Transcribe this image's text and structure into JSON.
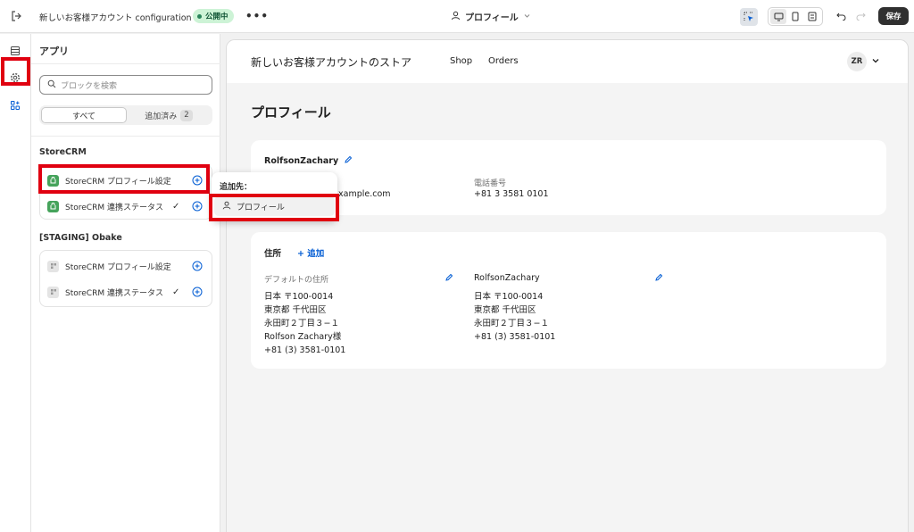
{
  "topbar": {
    "title": "新しいお客様アカウント configuration",
    "status": "公開中",
    "more": "•••",
    "page_selector": "プロフィール",
    "save": "保存"
  },
  "sidebar": {
    "title": "アプリ",
    "search_placeholder": "ブロックを検索",
    "tabs": {
      "all": "すべて",
      "added": "追加済み",
      "added_count": "2"
    },
    "groups": [
      {
        "name": "StoreCRM",
        "items": [
          {
            "label": "StoreCRM プロフィール設定",
            "added": false
          },
          {
            "label": "StoreCRM 連携ステータス",
            "added": true
          }
        ]
      },
      {
        "name": "[STAGING] Obake",
        "items": [
          {
            "label": "StoreCRM プロフィール設定",
            "added": false
          },
          {
            "label": "StoreCRM 連携ステータス",
            "added": true
          }
        ]
      }
    ],
    "check_mark": "✓"
  },
  "popover": {
    "title": "追加先：",
    "item": "プロフィール"
  },
  "preview": {
    "store_name": "新しいお客様アカウントのストア",
    "nav": [
      "Shop",
      "Orders"
    ],
    "avatar": "ZR",
    "page_title": "プロフィール",
    "profile_card": {
      "name": "RolfsonZachary",
      "email_partial": "xample.com",
      "phone_label": "電話番号",
      "phone": "+81 3 3581 0101"
    },
    "address_card": {
      "title": "住所",
      "add_label": "+ 追加",
      "default_label": "デフォルトの住所",
      "default_lines": [
        "日本 〒100-0014",
        "東京都 千代田区",
        "永田町２丁目３−１",
        "Rolfson Zachary様",
        "+81 (3) 3581-0101"
      ],
      "second_name": "RolfsonZachary",
      "second_lines": [
        "日本 〒100-0014",
        "東京都 千代田区",
        "永田町２丁目３−１",
        "+81 (3) 3581-0101"
      ]
    }
  },
  "colors": {
    "highlight": "#e00010",
    "accent": "#005bd3",
    "app_green": "#45a35b",
    "published_bg": "#cdf3d6"
  }
}
